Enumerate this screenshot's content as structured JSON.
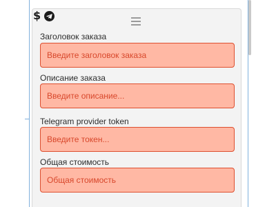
{
  "toolbar": {
    "icons": [
      "dollar-icon",
      "telegram-icon"
    ],
    "dollar_glyph": "$"
  },
  "colors": {
    "input_background": "#ffb8a4",
    "input_border": "#dd4e2e",
    "placeholder_text": "#d8472b",
    "card_background": "#f3f3f3",
    "telegram": "#1c1c1c"
  },
  "form": {
    "fields": [
      {
        "label": "Заголовок заказа",
        "placeholder": "Введите заголовок заказа"
      },
      {
        "label": "Описание заказа",
        "placeholder": "Введите описание..."
      },
      {
        "label": "Telegram provider token",
        "placeholder": "Введите токен..."
      },
      {
        "label": "Общая стоимость",
        "placeholder": "Общая стоимость"
      }
    ]
  }
}
